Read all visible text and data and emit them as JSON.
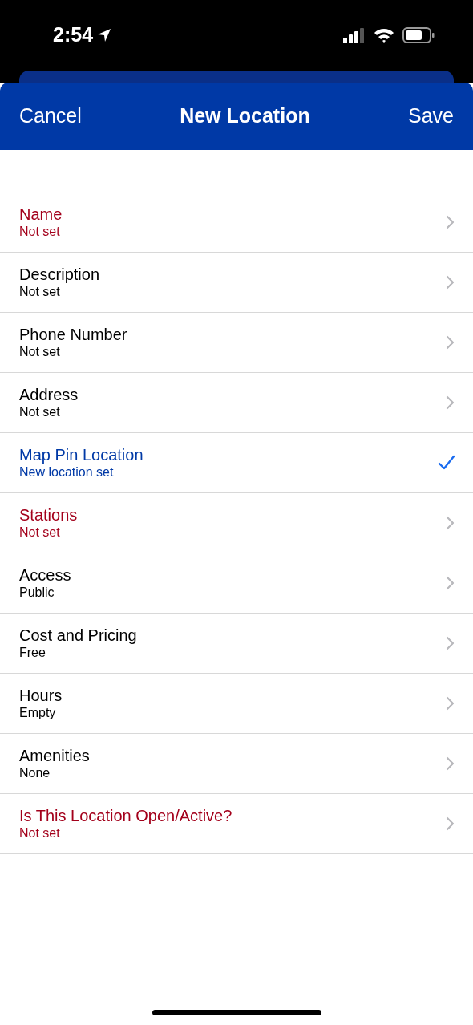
{
  "status_bar": {
    "time": "2:54"
  },
  "nav": {
    "cancel": "Cancel",
    "title": "New Location",
    "save": "Save"
  },
  "rows": [
    {
      "label": "Name",
      "value": "Not set",
      "kind": "required"
    },
    {
      "label": "Description",
      "value": "Not set",
      "kind": "plain"
    },
    {
      "label": "Phone Number",
      "value": "Not set",
      "kind": "plain"
    },
    {
      "label": "Address",
      "value": "Not set",
      "kind": "plain"
    },
    {
      "label": "Map Pin Location",
      "value": "New location set",
      "kind": "done"
    },
    {
      "label": "Stations",
      "value": "Not set",
      "kind": "required"
    },
    {
      "label": "Access",
      "value": "Public",
      "kind": "plain"
    },
    {
      "label": "Cost and Pricing",
      "value": "Free",
      "kind": "plain"
    },
    {
      "label": "Hours",
      "value": "Empty",
      "kind": "plain"
    },
    {
      "label": "Amenities",
      "value": "None",
      "kind": "plain"
    },
    {
      "label": "Is This Location Open/Active?",
      "value": "Not set",
      "kind": "required"
    }
  ]
}
